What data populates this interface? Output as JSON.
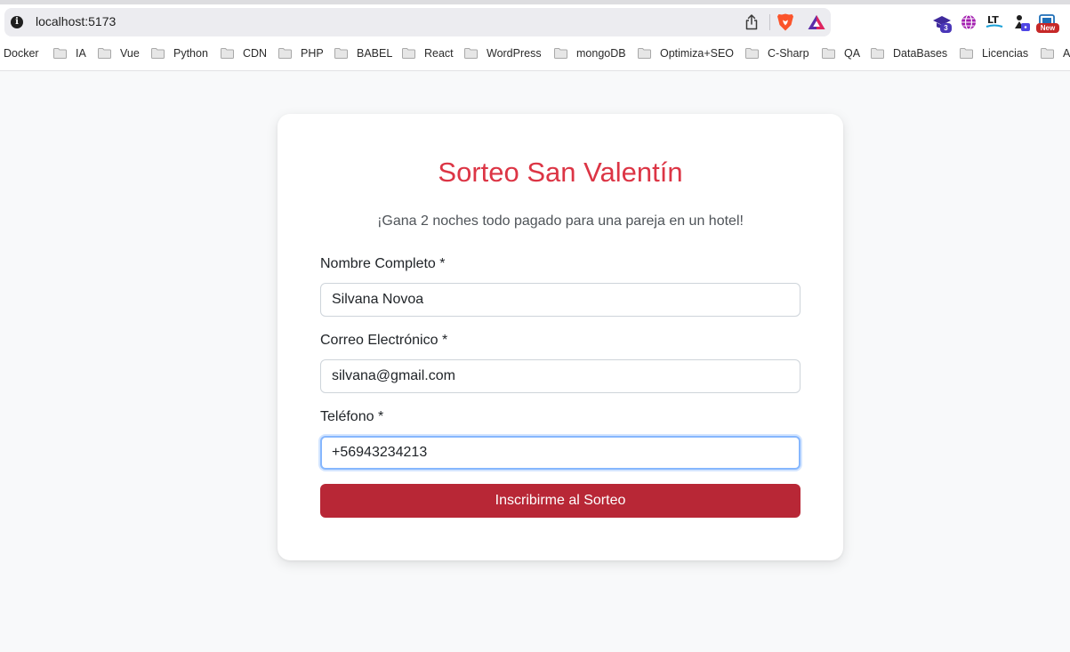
{
  "browser": {
    "url": "localhost:5173",
    "extensions": [
      {
        "icon": "graduation-cap-icon",
        "badge": "3"
      },
      {
        "icon": "globe-icon"
      },
      {
        "icon": "languagetool-icon",
        "text": "LT"
      },
      {
        "icon": "developer-tool-icon"
      },
      {
        "icon": "screen-tool-icon",
        "badge": "New"
      }
    ],
    "bookmarks": [
      "Docker",
      "IA",
      "Vue",
      "Python",
      "CDN",
      "PHP",
      "BABEL",
      "React",
      "WordPress",
      "mongoDB",
      "Optimiza+SEO",
      "C-Sharp",
      "QA",
      "DataBases",
      "Licencias",
      "AI"
    ]
  },
  "form": {
    "title": "Sorteo San Valentín",
    "subtitle": "¡Gana 2 noches todo pagado para una pareja en un hotel!",
    "fields": [
      {
        "label": "Nombre Completo *",
        "value": "Silvana Novoa"
      },
      {
        "label": "Correo Electrónico *",
        "value": "silvana@gmail.com"
      },
      {
        "label": "Teléfono *",
        "value": "+56943234213"
      }
    ],
    "submit_label": "Inscribirme al Sorteo"
  },
  "colors": {
    "title": "#dc3545",
    "button": "#b82736",
    "background": "#f8f9fa",
    "focus_border": "#86b7fe"
  }
}
